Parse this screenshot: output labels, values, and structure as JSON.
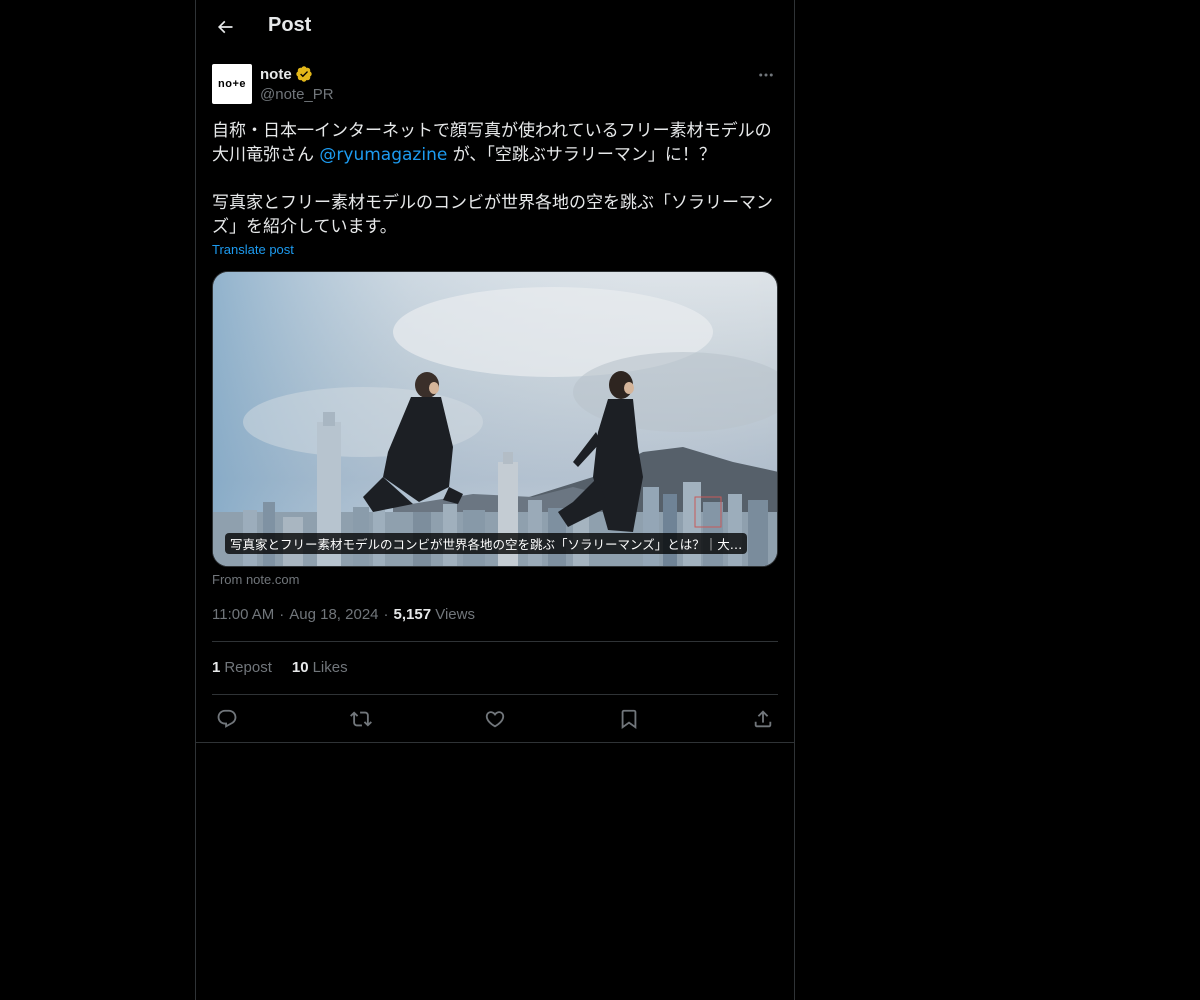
{
  "header": {
    "title": "Post",
    "back_icon": "arrow-left-icon"
  },
  "author": {
    "display_name": "note",
    "handle": "@note_PR",
    "avatar_text": "no+e",
    "verified_icon": "verified-gold-badge-icon",
    "verified_color": "#e2b719",
    "more_icon": "more-horizontal-icon"
  },
  "post": {
    "line1_prefix": "自称・日本一インターネットで顔写真が使われているフリー素材モデルの大川竜弥さん ",
    "mention": "@ryumagazine",
    "line1_suffix": " が、「空跳ぶサラリーマン」に！？",
    "line2": "写真家とフリー素材モデルのコンビが世界各地の空を跳ぶ「ソラリーマンズ」を紹介しています。",
    "translate_label": "Translate post"
  },
  "card": {
    "caption": "写真家とフリー素材モデルのコンビが世界各地の空を跳ぶ「ソラリーマンズ」とは？｜大…",
    "from_label": "From note.com"
  },
  "meta": {
    "time": "11:00 AM",
    "date": "Aug 18, 2024",
    "views_count": "5,157",
    "views_label": "Views"
  },
  "stats": {
    "reposts_count": "1",
    "reposts_label": "Repost",
    "likes_count": "10",
    "likes_label": "Likes"
  },
  "actions": {
    "reply_icon": "reply-icon",
    "repost_icon": "repost-icon",
    "like_icon": "heart-icon",
    "bookmark_icon": "bookmark-icon",
    "share_icon": "share-icon"
  },
  "colors": {
    "background": "#000000",
    "text_primary": "#e7e9ea",
    "text_secondary": "#71767b",
    "accent": "#1d9bf0",
    "border": "#2f3336"
  }
}
